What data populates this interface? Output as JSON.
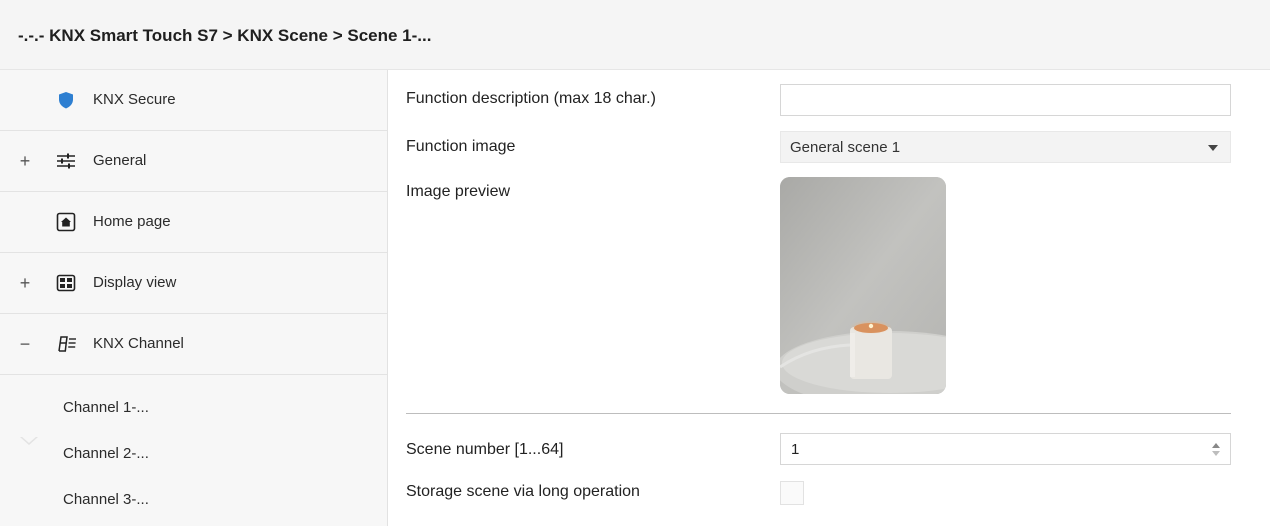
{
  "breadcrumb": "-.-.- KNX Smart Touch S7 > KNX Scene > Scene 1-...",
  "sidebar": {
    "items": [
      {
        "label": "KNX Secure",
        "expander": "",
        "icon": "shield-icon"
      },
      {
        "label": "General",
        "expander": "+",
        "icon": "sliders-icon"
      },
      {
        "label": "Home page",
        "expander": "",
        "icon": "home-icon"
      },
      {
        "label": "Display view",
        "expander": "+",
        "icon": "display-grid-icon"
      },
      {
        "label": "KNX Channel",
        "expander": "−",
        "icon": "knx-channel-icon"
      }
    ],
    "subitems": [
      {
        "label": "Channel 1-..."
      },
      {
        "label": "Channel 2-..."
      },
      {
        "label": "Channel 3-..."
      }
    ]
  },
  "form": {
    "function_description": {
      "label": "Function description (max 18 char.)",
      "value": ""
    },
    "function_image": {
      "label": "Function image",
      "value": "General scene 1"
    },
    "image_preview": {
      "label": "Image preview"
    },
    "scene_number": {
      "label": "Scene number [1...64]",
      "value": "1"
    },
    "storage_scene": {
      "label": "Storage scene via long operation",
      "checked": false
    }
  },
  "colors": {
    "shield": "#2e7fd1",
    "sidebar_bg": "#f7f7f7",
    "titlebar_bg": "#f5f5f5"
  }
}
